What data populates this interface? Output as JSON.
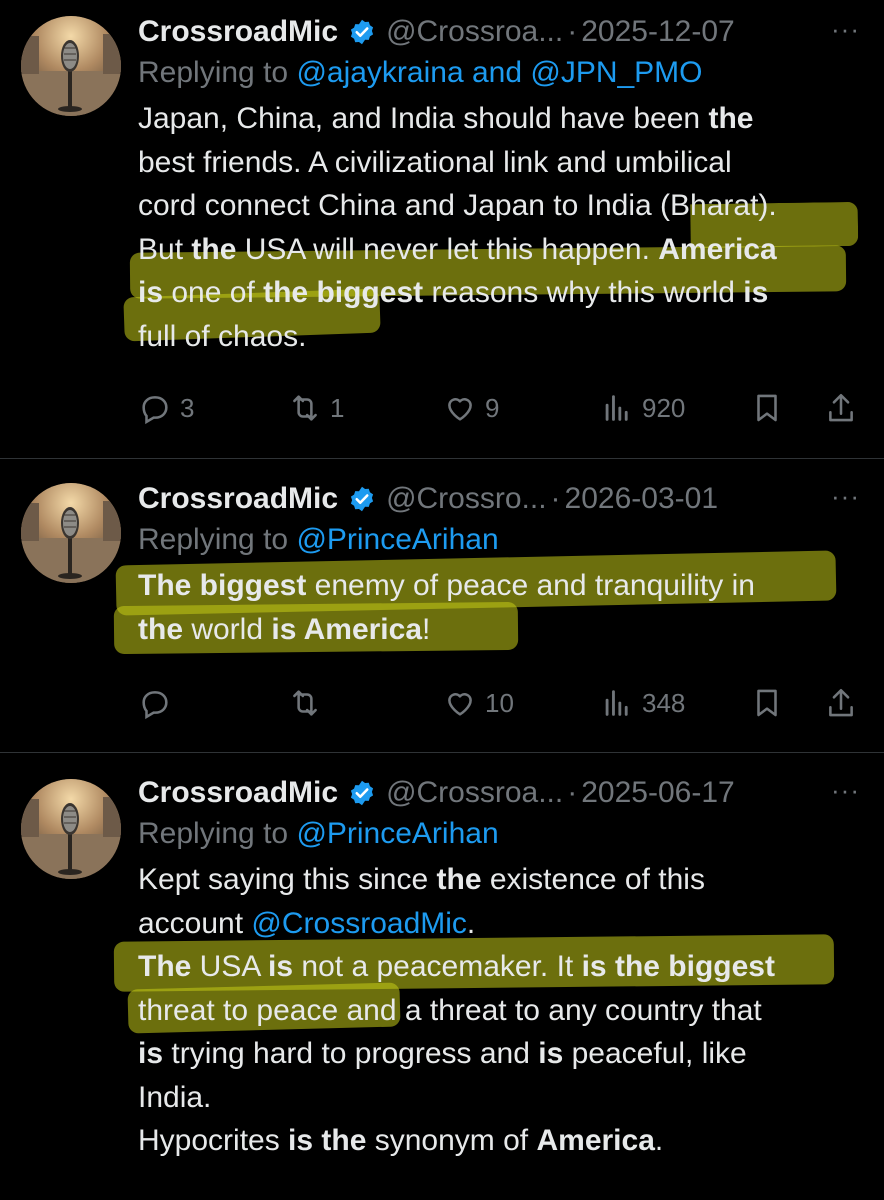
{
  "tweets": [
    {
      "name": "CrossroadMic",
      "handle": "@Crossroa...",
      "dot": "·",
      "date": "2025-12-07",
      "more": "···",
      "replying_prefix": "Replying to",
      "replying_to": "@ajaykraina and @JPN_PMO",
      "actions": {
        "replies": "3",
        "retweets": "1",
        "likes": "9",
        "views": "920"
      }
    },
    {
      "name": "CrossroadMic",
      "handle": "@Crossro...",
      "dot": "·",
      "date": "2026-03-01",
      "more": "···",
      "replying_prefix": "Replying to",
      "replying_to": "@PrinceArihan",
      "actions": {
        "replies": "",
        "retweets": "",
        "likes": "10",
        "views": "348"
      }
    },
    {
      "name": "CrossroadMic",
      "handle": "@Crossroa...",
      "dot": "·",
      "date": "2025-06-17",
      "more": "···",
      "replying_prefix": "Replying to",
      "replying_to": "@PrinceArihan"
    }
  ],
  "bodies": {
    "t1": {
      "l1a": "Japan, China, and India should have been ",
      "l1b": "the",
      "l2": "best friends. A civilizational link and umbilical",
      "l3": "cord connect China and Japan to India (Bharat).",
      "l4a": "But ",
      "l4b": "the",
      "l4c": " USA will never let this happen. ",
      "l4d": "America",
      "l5a": "is",
      "l5b": " one of ",
      "l5c": "the biggest",
      "l5d": " reasons why this world ",
      "l5e": "is",
      "l6": "full of chaos."
    },
    "t2": {
      "l1a": "The biggest",
      "l1b": " enemy of peace and tranquility in",
      "l2a": "the",
      "l2b": " world ",
      "l2c": "is America",
      "l2d": "!"
    },
    "t3": {
      "l1a": "Kept saying this since ",
      "l1b": "the",
      "l1c": " existence of this",
      "l2a": "account ",
      "l2b": "@CrossroadMic",
      "l2c": ".",
      "l3a": "The",
      "l3b": " USA ",
      "l3c": "is",
      "l3d": " not a peacemaker. It ",
      "l3e": "is the biggest",
      "l4": "threat to peace and a threat to any country that",
      "l5a": "is",
      "l5b": " trying hard to progress and ",
      "l5c": "is",
      "l5d": " peaceful, like",
      "l6": "India.",
      "l7a": "Hypocrites ",
      "l7b": "is the",
      "l7c": " synonym of ",
      "l7d": "America",
      "l7e": "."
    }
  },
  "colors": {
    "background": "#000000",
    "text": "#e7e9ea",
    "muted": "#71767b",
    "link": "#1d9bf0",
    "verified": "#1d9bf0",
    "highlight": "#c4ca18"
  },
  "icons": [
    "verified-badge-icon",
    "reply-icon",
    "retweet-icon",
    "like-icon",
    "views-icon",
    "bookmark-icon",
    "share-icon",
    "more-icon"
  ]
}
